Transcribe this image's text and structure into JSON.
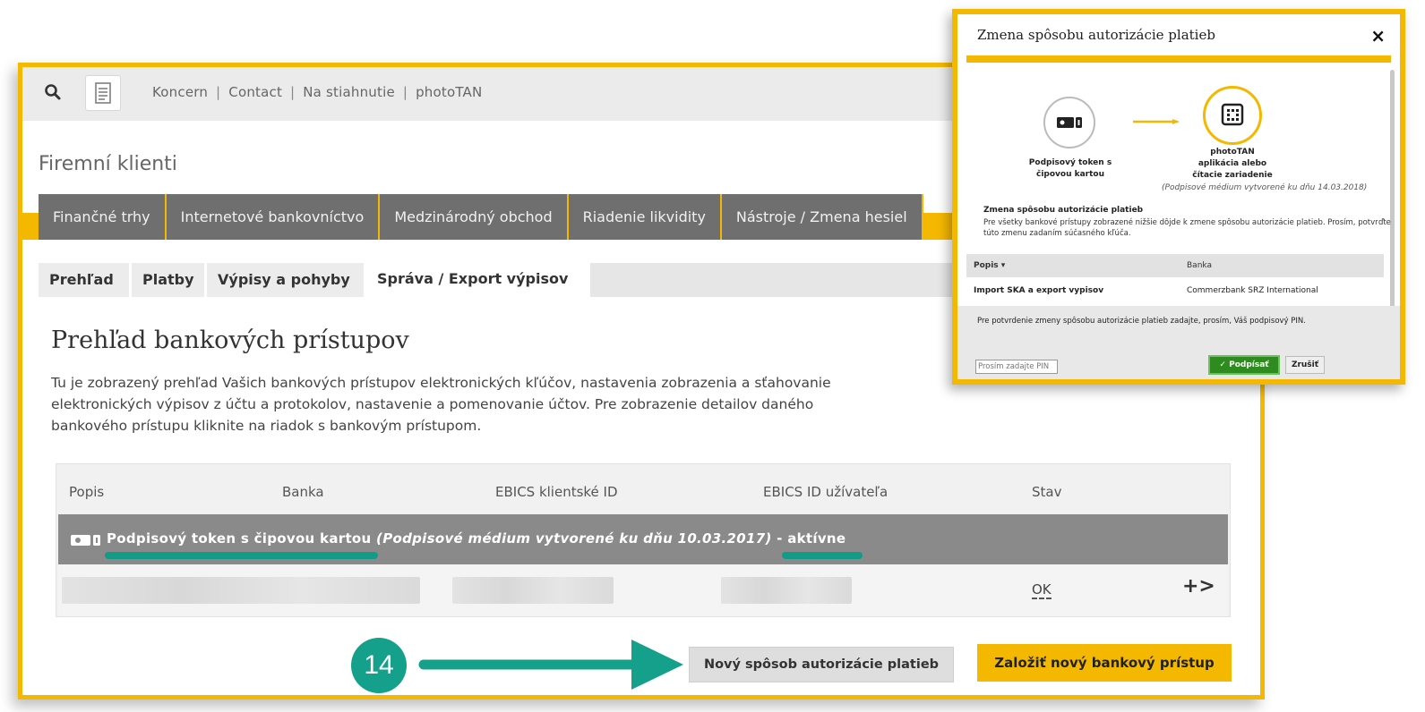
{
  "header": {
    "links": [
      "Koncern",
      "Contact",
      "Na stiahnutie",
      "photoTAN"
    ],
    "separator": "|"
  },
  "page_title": "Firemní klienti",
  "main_nav": [
    "Finančné trhy",
    "Internetové bankovníctvo",
    "Medzinárodný obchod",
    "Riadenie likvidity",
    "Nástroje / Zmena hesiel"
  ],
  "sub_tabs": [
    "Prehľad",
    "Platby",
    "Výpisy a pohyby",
    "Správa / Export výpisov"
  ],
  "section": {
    "title": "Prehľad bankových prístupov",
    "intro": "Tu je zobrazený prehľad Vašich bankových prístupov elektronických kľúčov, nastavenia zobrazenia a sťahovanie elektronických výpisov z účtu a protokolov, nastavenie a pomenovanie účtov. Pre zobrazenie detailov daného bankového prístupu kliknite na riadok s bankovým prístupom."
  },
  "table": {
    "headers": [
      "Popis",
      "Banka",
      "EBICS klientské ID",
      "EBICS ID užívateľa",
      "Stav"
    ],
    "group": {
      "name": "Podpisový token s čipovou kartou",
      "note": "(Podpisové médium vytvorené ku dňu 10.03.2017)",
      "dash": "-",
      "status": "aktívne"
    },
    "row": {
      "status": "OK",
      "action": "+>"
    }
  },
  "step": {
    "number": "14"
  },
  "buttons": {
    "new_auth": "Nový spôsob autorizácie platieb",
    "new_access": "Založiť nový bankový prístup"
  },
  "modal": {
    "title": "Zmena spôsobu autorizácie platieb",
    "close": "×",
    "from_label": [
      "Podpisový token s",
      "čipovou kartou"
    ],
    "to_label": [
      "photoTAN",
      "aplikácia alebo",
      "čítacie zariadenie"
    ],
    "to_note": "(Podpisové médium vytvorené ku dňu 14.03.2018)",
    "heading": "Zmena spôsobu autorizácie platieb",
    "text": "Pre všetky bankové prístupy zobrazené nižšie dôjde k zmene spôsobu autorizácie platieb. Prosím, potvrďte túto zmenu zadaním súčasného kľúča.",
    "table_headers": [
      "Popis ▾",
      "Banka"
    ],
    "table_row": [
      "Import SKA a export vypisov",
      "Commerzbank SRZ International"
    ],
    "confirm_note": "Pre potvrdenie zmeny spôsobu autorizácie platieb zadajte, prosím, Váš podpisový PIN.",
    "pin_placeholder": "Prosím zadajte PIN",
    "sign_button": "✓ Podpísať",
    "cancel_button": "Zrušiť"
  },
  "colors": {
    "accent": "#f5b800",
    "teal": "#15a08b",
    "nav_bg": "#6f6f6f",
    "group_row": "#8a8a8a"
  }
}
